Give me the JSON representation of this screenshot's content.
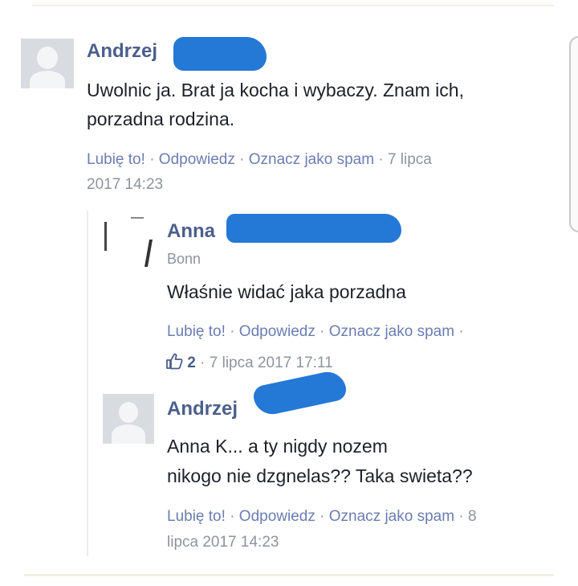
{
  "colors": {
    "author_link": "#4b5f8c",
    "action_link": "#6b7db3",
    "meta_gray": "#8d949e",
    "redaction": "#2478d6"
  },
  "comments": [
    {
      "author": "Andrzej",
      "text_lines": [
        "Uwolnic ja. Brat ja kocha i wybaczy. Znam ich,",
        "porzadna rodzina."
      ],
      "actions": {
        "like": "Lubię to!",
        "reply": "Odpowiedz",
        "spam": "Oznacz jako spam"
      },
      "date_line1": "7 lipca",
      "date_line2": "2017 14:23"
    },
    {
      "author": "Anna",
      "location": "Bonn",
      "text_lines": [
        "Właśnie widać jaka porzadna"
      ],
      "actions": {
        "like": "Lubię to!",
        "reply": "Odpowiedz",
        "spam": "Oznacz jako spam"
      },
      "like_icon": "thumbs-up-icon",
      "like_count": "2",
      "date": "7 lipca 2017 17:11"
    },
    {
      "author": "Andrzej",
      "text_lines": [
        "Anna K...  a ty nigdy nozem",
        "nikogo nie dzgnelas?? Taka swieta??"
      ],
      "actions": {
        "like": "Lubię to!",
        "reply": "Odpowiedz",
        "spam": "Oznacz jako spam"
      },
      "date_line1": "8",
      "date_line2": "lipca 2017 14:23"
    }
  ]
}
